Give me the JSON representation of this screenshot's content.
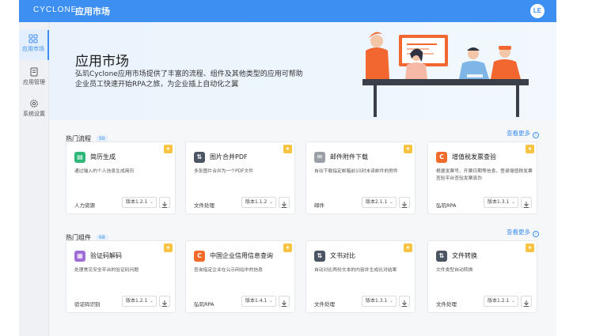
{
  "header": {
    "brand": "CYCLONE",
    "title": "应用市场",
    "avatar": "LE",
    "brand_color": "#3d8ff2"
  },
  "sidebar": {
    "items": [
      {
        "label": "应用市场",
        "icon": "grid-icon",
        "active": true
      },
      {
        "label": "应用管理",
        "icon": "document-icon",
        "active": false
      },
      {
        "label": "系统设置",
        "icon": "gear-icon",
        "active": false
      }
    ]
  },
  "hero": {
    "title": "应用市场",
    "description": "弘玑Cyclone应用市场提供了丰富的流程、组件及其他类型的应用可帮助企业员工快速开始RPA之旅，为企业插上自动化之翼"
  },
  "sections": [
    {
      "title": "热门流程",
      "count": "99",
      "more": "查看更多",
      "cards": [
        {
          "name": "简历生成",
          "icon": "resume-icon",
          "icon_color": "#2db87a",
          "desc": "通过输入的个人信息生成简历",
          "category": "人力资源",
          "version": "版本1.2.1"
        },
        {
          "name": "图片合并PDF",
          "icon": "merge-icon",
          "icon_color": "#4b5563",
          "desc": "多张图片合并为一个PDF文件",
          "category": "文件处理",
          "version": "版本1.1.2"
        },
        {
          "name": "邮件附件下载",
          "icon": "mail-icon",
          "icon_color": "#9aa0a6",
          "desc": "自动下载指定邮箱前10封未读邮件的附件",
          "category": "邮件",
          "version": "版本2.1.1"
        },
        {
          "name": "增值税发票查验",
          "icon": "c-letter-icon",
          "icon_color": "#f26b2a",
          "desc": "根据发票号、开票日期等信息，登录增值税发票查验平台查验发票真伪",
          "category": "弘玑RPA",
          "version": "版本1.3.1"
        }
      ]
    },
    {
      "title": "热门组件",
      "count": "68",
      "more": "查看更多",
      "cards": [
        {
          "name": "验证码解码",
          "icon": "captcha-icon",
          "icon_color": "#a06cd5",
          "desc": "处理常见安全平台的验证码问题",
          "category": "验证码识别",
          "version": "版本1.2.1"
        },
        {
          "name": "中国企业信用信息查询",
          "icon": "c-letter-icon",
          "icon_color": "#f26b2a",
          "desc": "查询指定企业在公示网站中的信息",
          "category": "弘玑RPA",
          "version": "版本1.4.1"
        },
        {
          "name": "文书对比",
          "icon": "compare-icon",
          "icon_color": "#4b5563",
          "desc": "自动对比两份文本的内容并生成比对结果",
          "category": "文件处理",
          "version": "版本1.3.1"
        },
        {
          "name": "文件转换",
          "icon": "convert-icon",
          "icon_color": "#4b5563",
          "desc": "文件类型自动转换",
          "category": "文件处理",
          "version": "版本1.2.1"
        }
      ]
    }
  ]
}
